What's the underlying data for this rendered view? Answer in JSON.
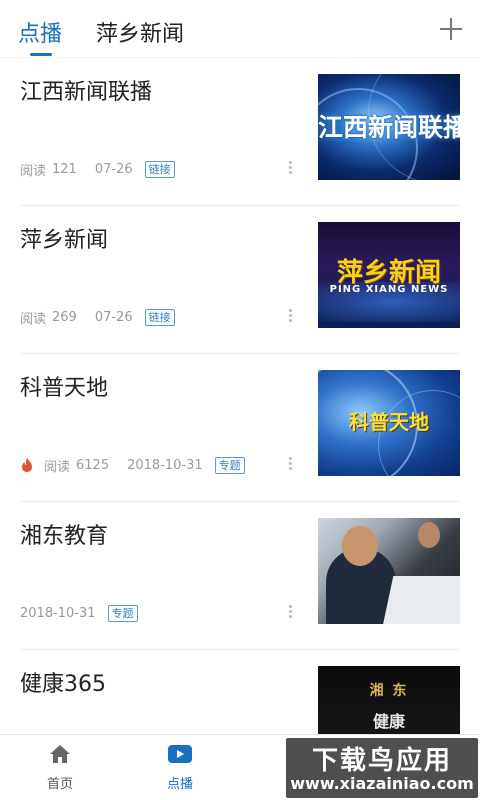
{
  "header": {
    "tabs": [
      {
        "label": "点播",
        "active": true
      },
      {
        "label": "萍乡新闻",
        "active": false
      }
    ],
    "add_icon": "plus-icon"
  },
  "feed": {
    "items": [
      {
        "title": "江西新闻联播",
        "reads_label": "阅读",
        "reads": "121",
        "date": "07-26",
        "tag": "链接",
        "thumb_text": "江西新闻联播"
      },
      {
        "title": "萍乡新闻",
        "reads_label": "阅读",
        "reads": "269",
        "date": "07-26",
        "tag": "链接",
        "thumb_text": "萍乡新闻",
        "thumb_sub": "PING XIANG NEWS"
      },
      {
        "title": "科普天地",
        "reads_label": "阅读",
        "reads": "6125",
        "date": "2018-10-31",
        "tag": "专题",
        "hot_icon": "flame-icon",
        "thumb_text": "科普天地"
      },
      {
        "title": "湘东教育",
        "date": "2018-10-31",
        "tag": "专题"
      },
      {
        "title": "健康365",
        "thumb_text": "湘 东",
        "thumb_sub": "健康"
      }
    ]
  },
  "tabbar": {
    "items": [
      {
        "label": "首页",
        "icon": "home-icon"
      },
      {
        "label": "点播",
        "icon": "play-icon",
        "active": true
      }
    ]
  },
  "watermark": {
    "title": "下载鸟应用",
    "url": "www.xiazainiao.com"
  },
  "colors": {
    "accent": "#1a6fc1",
    "tag_border": "#5a9bd8",
    "meta_text": "#999999"
  }
}
